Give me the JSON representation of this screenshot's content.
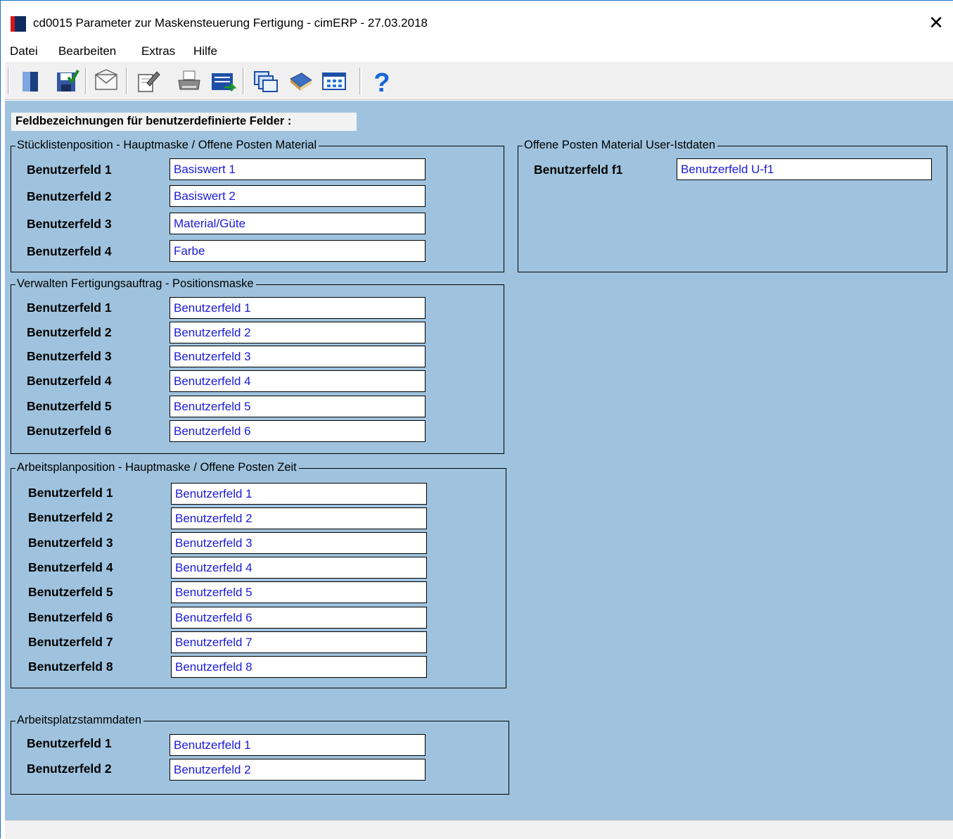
{
  "window": {
    "title": "cd0015 Parameter zur Maskensteuerung Fertigung - cimERP - 27.03.2018",
    "close_glyph": "✕"
  },
  "menu": [
    "Datei",
    "Bearbeiten",
    "Extras",
    "Hilfe"
  ],
  "toolbar": {
    "buttons": [
      "exit-icon",
      "save-icon",
      "mail-icon",
      "edit-icon",
      "print-icon",
      "transfer-icon",
      "windows-icon",
      "book-icon",
      "grid-icon",
      "help-icon"
    ]
  },
  "heading": "Feldbezeichnungen für benutzerdefinierte Felder :",
  "groups": [
    {
      "title": "Stücklistenposition - Hauptmaske / Offene Posten Material",
      "rows": [
        {
          "label": "Benutzerfeld 1",
          "value": "Basiswert 1"
        },
        {
          "label": "Benutzerfeld 2",
          "value": "Basiswert 2"
        },
        {
          "label": "Benutzerfeld 3",
          "value": "Material/Güte"
        },
        {
          "label": "Benutzerfeld 4",
          "value": "Farbe"
        }
      ]
    },
    {
      "title": "Offene Posten Material User-Istdaten",
      "rows": [
        {
          "label": "Benutzerfeld f1",
          "value": "Benutzerfeld U-f1"
        }
      ]
    },
    {
      "title": "Verwalten Fertigungsauftrag - Positionsmaske",
      "rows": [
        {
          "label": "Benutzerfeld 1",
          "value": "Benutzerfeld 1"
        },
        {
          "label": "Benutzerfeld 2",
          "value": "Benutzerfeld 2"
        },
        {
          "label": "Benutzerfeld 3",
          "value": "Benutzerfeld 3"
        },
        {
          "label": "Benutzerfeld 4",
          "value": "Benutzerfeld 4"
        },
        {
          "label": "Benutzerfeld 5",
          "value": "Benutzerfeld 5"
        },
        {
          "label": "Benutzerfeld 6",
          "value": "Benutzerfeld 6"
        }
      ]
    },
    {
      "title": "Arbeitsplanposition - Hauptmaske / Offene Posten Zeit",
      "rows": [
        {
          "label": "Benutzerfeld 1",
          "value": "Benutzerfeld 1"
        },
        {
          "label": "Benutzerfeld 2",
          "value": "Benutzerfeld 2"
        },
        {
          "label": "Benutzerfeld 3",
          "value": "Benutzerfeld 3"
        },
        {
          "label": "Benutzerfeld 4",
          "value": "Benutzerfeld 4"
        },
        {
          "label": "Benutzerfeld 5",
          "value": "Benutzerfeld 5"
        },
        {
          "label": "Benutzerfeld 6",
          "value": "Benutzerfeld 6"
        },
        {
          "label": "Benutzerfeld 7",
          "value": "Benutzerfeld 7"
        },
        {
          "label": "Benutzerfeld 8",
          "value": "Benutzerfeld 8"
        }
      ]
    },
    {
      "title": "Arbeitsplatzstammdaten",
      "rows": [
        {
          "label": "Benutzerfeld 1",
          "value": "Benutzerfeld 1"
        },
        {
          "label": "Benutzerfeld 2",
          "value": "Benutzerfeld 2"
        }
      ]
    }
  ],
  "colors": {
    "content_bg": "#9fc3de",
    "input_text": "#1b1bd6",
    "brand_red": "#d8141b",
    "brand_navy": "#0f2a5c"
  }
}
